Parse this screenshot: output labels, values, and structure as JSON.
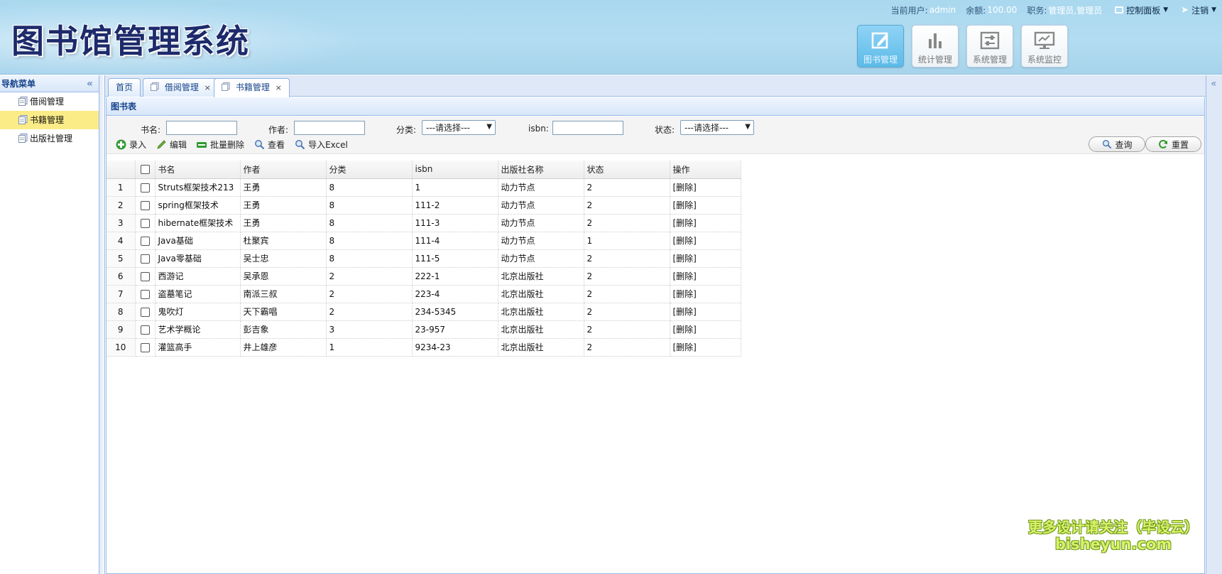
{
  "header": {
    "app_title": "图书馆管理系统",
    "current_user_label": "当前用户:",
    "current_user_value": "admin",
    "balance_label": "余额:",
    "balance_value": "100.00",
    "role_label": "职务:",
    "role_value": "管理员,管理员",
    "control_panel_label": "控制面板",
    "logout_label": "注销",
    "modules": [
      {
        "label": "图书管理",
        "icon": "edit-icon",
        "active": true
      },
      {
        "label": "统计管理",
        "icon": "bar-chart-icon",
        "active": false
      },
      {
        "label": "系统管理",
        "icon": "sliders-icon",
        "active": false
      },
      {
        "label": "系统监控",
        "icon": "monitor-icon",
        "active": false
      }
    ]
  },
  "nav": {
    "title": "导航菜单",
    "items": [
      {
        "label": "借阅管理",
        "active": false
      },
      {
        "label": "书籍管理",
        "active": true
      },
      {
        "label": "出版社管理",
        "active": false
      }
    ]
  },
  "tabs": [
    {
      "label": "首页",
      "closable": false,
      "active": false
    },
    {
      "label": "借阅管理",
      "closable": true,
      "active": false
    },
    {
      "label": "书籍管理",
      "closable": true,
      "active": true
    }
  ],
  "panel": {
    "title": "图书表",
    "search": {
      "book_name_label": "书名:",
      "book_name_value": "",
      "author_label": "作者:",
      "author_value": "",
      "category_label": "分类:",
      "category_selected": "---请选择---",
      "isbn_label": "isbn:",
      "isbn_value": "",
      "status_label": "状态:",
      "status_selected": "---请选择---"
    },
    "toolbar": {
      "add": "录入",
      "edit": "编辑",
      "batch_delete": "批量删除",
      "view": "查看",
      "import_excel": "导入Excel",
      "query": "查询",
      "reset": "重置"
    },
    "grid": {
      "columns": [
        "书名",
        "作者",
        "分类",
        "isbn",
        "出版社名称",
        "状态",
        "操作"
      ],
      "rows": [
        {
          "no": "1",
          "name": "Struts框架技术213",
          "author": "王勇",
          "category": "8",
          "isbn": "1",
          "publisher": "动力节点",
          "status": "2",
          "action": "[删除]"
        },
        {
          "no": "2",
          "name": "spring框架技术",
          "author": "王勇",
          "category": "8",
          "isbn": "111-2",
          "publisher": "动力节点",
          "status": "2",
          "action": "[删除]"
        },
        {
          "no": "3",
          "name": "hibernate框架技术",
          "author": "王勇",
          "category": "8",
          "isbn": "111-3",
          "publisher": "动力节点",
          "status": "2",
          "action": "[删除]"
        },
        {
          "no": "4",
          "name": "Java基础",
          "author": "杜聚宾",
          "category": "8",
          "isbn": "111-4",
          "publisher": "动力节点",
          "status": "1",
          "action": "[删除]"
        },
        {
          "no": "5",
          "name": "Java零基础",
          "author": "吴士忠",
          "category": "8",
          "isbn": "111-5",
          "publisher": "动力节点",
          "status": "2",
          "action": "[删除]"
        },
        {
          "no": "6",
          "name": "西游记",
          "author": "吴承恩",
          "category": "2",
          "isbn": "222-1",
          "publisher": "北京出版社",
          "status": "2",
          "action": "[删除]"
        },
        {
          "no": "7",
          "name": "盗墓笔记",
          "author": "南派三叔",
          "category": "2",
          "isbn": "223-4",
          "publisher": "北京出版社",
          "status": "2",
          "action": "[删除]"
        },
        {
          "no": "8",
          "name": "鬼吹灯",
          "author": "天下霸唱",
          "category": "2",
          "isbn": "234-5345",
          "publisher": "北京出版社",
          "status": "2",
          "action": "[删除]"
        },
        {
          "no": "9",
          "name": "艺术学概论",
          "author": "彭吉象",
          "category": "3",
          "isbn": "23-957",
          "publisher": "北京出版社",
          "status": "2",
          "action": "[删除]"
        },
        {
          "no": "10",
          "name": "灌篮高手",
          "author": "井上雄彦",
          "category": "1",
          "isbn": "9234-23",
          "publisher": "北京出版社",
          "status": "2",
          "action": "[删除]"
        }
      ]
    }
  },
  "watermark": {
    "line1": "更多设计请关注（毕设云）",
    "line2": "bisheyun.com"
  },
  "colors": {
    "header_bg": "#a9d8ef",
    "title_color": "#1d2a6b",
    "active_nav": "#fbec88",
    "panel_border": "#99bbe8",
    "module_active": "#5cbbe8"
  }
}
